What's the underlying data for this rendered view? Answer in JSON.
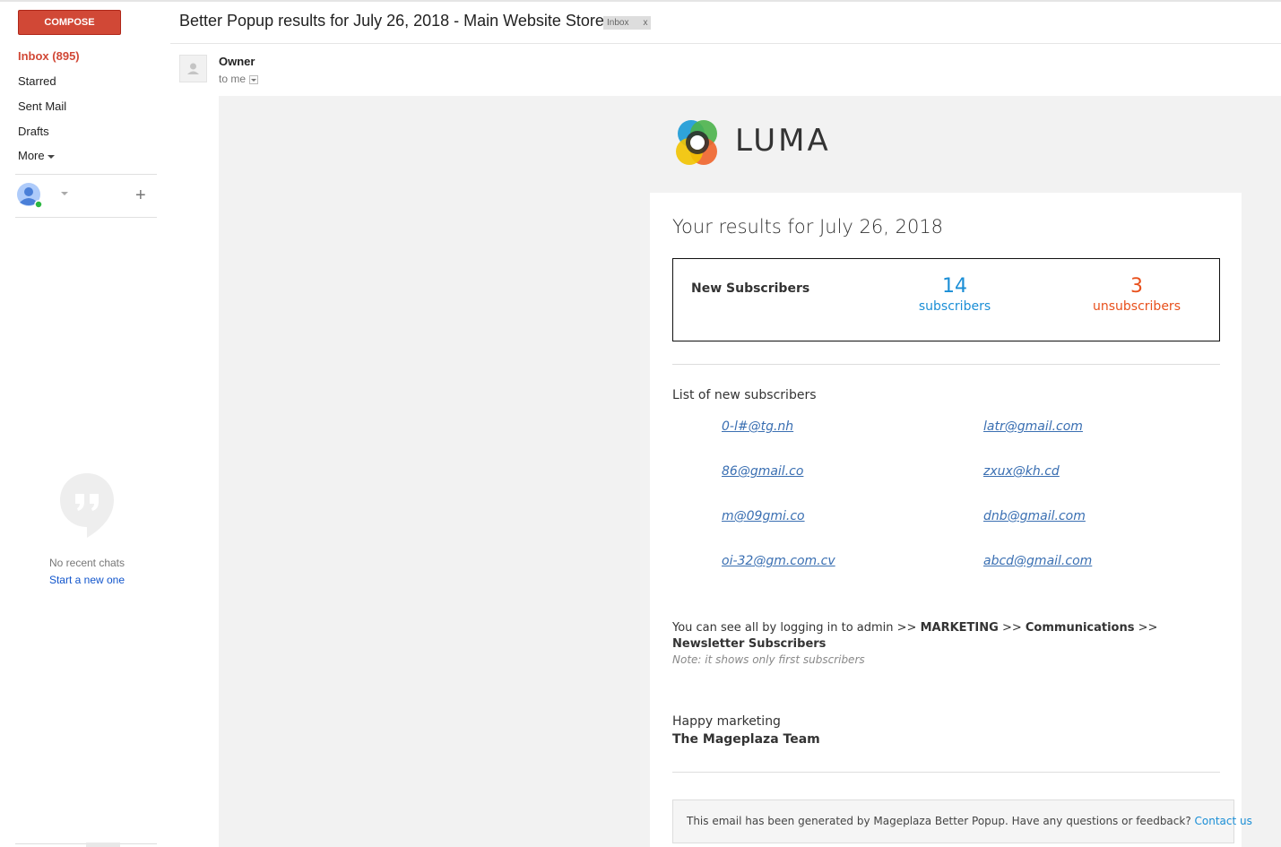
{
  "nav": {
    "compose_label": "COMPOSE",
    "inbox_label": "Inbox (895)",
    "starred_label": "Starred",
    "sent_label": "Sent Mail",
    "drafts_label": "Drafts",
    "more_label": "More",
    "accent_color": "#d14836"
  },
  "chat": {
    "no_chats": "No recent chats",
    "start_new": "Start a new one"
  },
  "message": {
    "subject": "Better Popup results for July 26, 2018 - Main Website Store",
    "label_name": "Inbox",
    "label_remove": "x",
    "sender": "Owner",
    "recipient": "to me"
  },
  "email": {
    "brand": "LUMA",
    "title": "Your results for July 26, 2018",
    "stats_label": "New Subscribers",
    "subscribers_count": "14",
    "subscribers_label": "subscribers",
    "unsubscribers_count": "3",
    "unsubscribers_label": "unsubscribers",
    "list_title": "List of new subscribers",
    "subscribers": [
      "0-l#@tg.nh",
      "latr@gmail.com",
      "86@gmail.co",
      "zxux@kh.cd",
      "m@09gmi.co",
      "dnb@gmail.com",
      "oi-32@gm.com.cv",
      "abcd@gmail.com"
    ],
    "admin_prefix": "You can see all by logging in to admin >> ",
    "admin_marketing": "MARKETING",
    "admin_sep1": " >> ",
    "admin_communications": "Communications",
    "admin_sep2": " >> ",
    "admin_newsletter": "Newsletter Subscribers",
    "note": "Note: it shows only first subscribers",
    "happy": "Happy marketing",
    "team": "The Mageplaza Team",
    "footer_text": "This email has been generated by Mageplaza Better Popup. Have any questions or feedback? ",
    "footer_link": "Contact us",
    "colors": {
      "subscribers": "#1a8ed6",
      "unsubscribers": "#e8501c"
    }
  }
}
